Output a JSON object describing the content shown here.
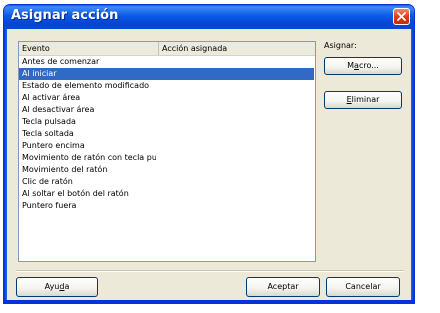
{
  "window": {
    "title": "Asignar acción"
  },
  "list": {
    "columns": [
      "Evento",
      "Acción asignada"
    ],
    "rows": [
      "Antes de comenzar",
      "Al iniciar",
      "Estado de elemento modificado",
      "Al activar área",
      "Al desactivar área",
      "Tecla pulsada",
      "Tecla soltada",
      "Puntero encima",
      "Movimiento de ratón con tecla pu",
      "Movimiento del ratón",
      "Clic de ratón",
      "Al soltar el botón del ratón",
      "Puntero fuera"
    ],
    "selected_row": "Al iniciar"
  },
  "side": {
    "assign_label": "Asignar:",
    "macro_button": {
      "pre": "M",
      "mnemonic": "a",
      "post": "cro..."
    },
    "delete_button": {
      "pre": "",
      "mnemonic": "E",
      "post": "liminar"
    }
  },
  "footer": {
    "help_button": {
      "pre": "Ayu",
      "mnemonic": "d",
      "post": "a"
    },
    "accept_button": "Aceptar",
    "cancel_button": "Cancelar"
  },
  "colors": {
    "title_bar": "#0a5fec",
    "selection": "#316ac5",
    "close_button": "#d93b13"
  },
  "icons": {
    "close": "close-icon"
  }
}
